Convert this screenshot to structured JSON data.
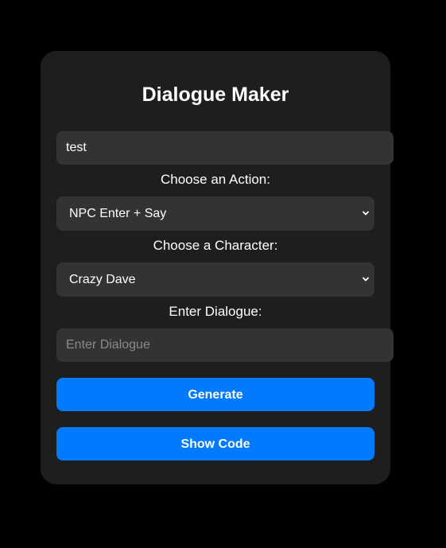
{
  "card": {
    "title": "Dialogue Maker"
  },
  "name_input": {
    "value": "test"
  },
  "action": {
    "label": "Choose an Action:",
    "selected": "NPC Enter + Say"
  },
  "character": {
    "label": "Choose a Character:",
    "selected": "Crazy Dave"
  },
  "dialogue": {
    "label": "Enter Dialogue:",
    "placeholder": "Enter Dialogue",
    "value": ""
  },
  "buttons": {
    "generate_label": "Generate",
    "show_code_label": "Show Code"
  },
  "colors": {
    "background": "#000000",
    "card": "#1e1e1e",
    "field": "#333333",
    "accent": "#007bff",
    "text": "#ffffff"
  },
  "icons": {
    "select_arrow": "chevron-down-icon"
  }
}
